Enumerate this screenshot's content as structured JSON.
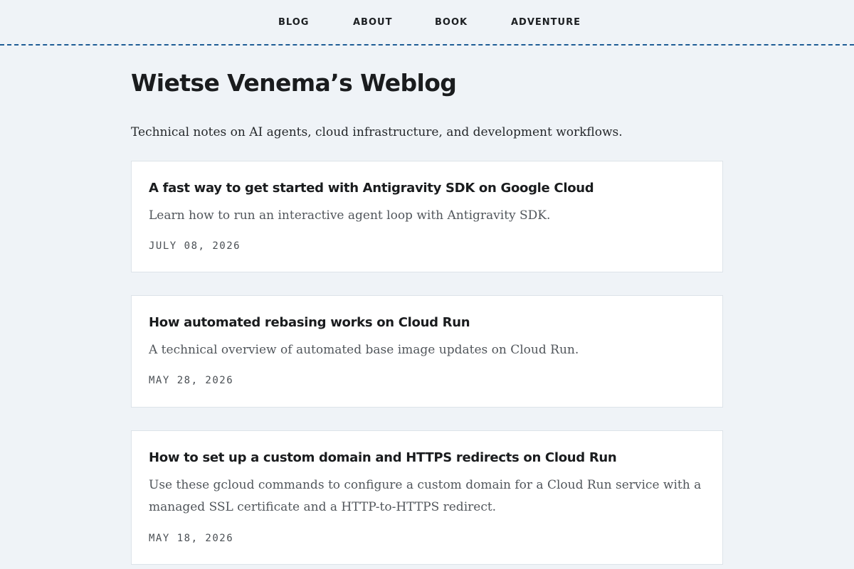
{
  "nav": {
    "items": [
      {
        "label": "BLOG"
      },
      {
        "label": "ABOUT"
      },
      {
        "label": "BOOK"
      },
      {
        "label": "ADVENTURE"
      }
    ]
  },
  "header": {
    "title": "Wietse Venema’s Weblog",
    "subtitle": "Technical notes on AI agents, cloud infrastructure, and development workflows."
  },
  "posts": [
    {
      "title": "A fast way to get started with Antigravity SDK on Google Cloud",
      "summary": "Learn how to run an interactive agent loop with Antigravity SDK.",
      "date": "JULY 08, 2026"
    },
    {
      "title": "How automated rebasing works on Cloud Run",
      "summary": "A technical overview of automated base image updates on Cloud Run.",
      "date": "MAY 28, 2026"
    },
    {
      "title": "How to set up a custom domain and HTTPS redirects on Cloud Run",
      "summary": "Use these gcloud commands to configure a custom domain for a Cloud Run service with a managed SSL certificate and a HTTP-to-HTTPS redirect.",
      "date": "MAY 18, 2026"
    }
  ],
  "colors": {
    "background": "#eff3f7",
    "card": "#ffffff",
    "accent": "#1f5d96",
    "text": "#1a1c1e",
    "muted": "#51565b"
  }
}
